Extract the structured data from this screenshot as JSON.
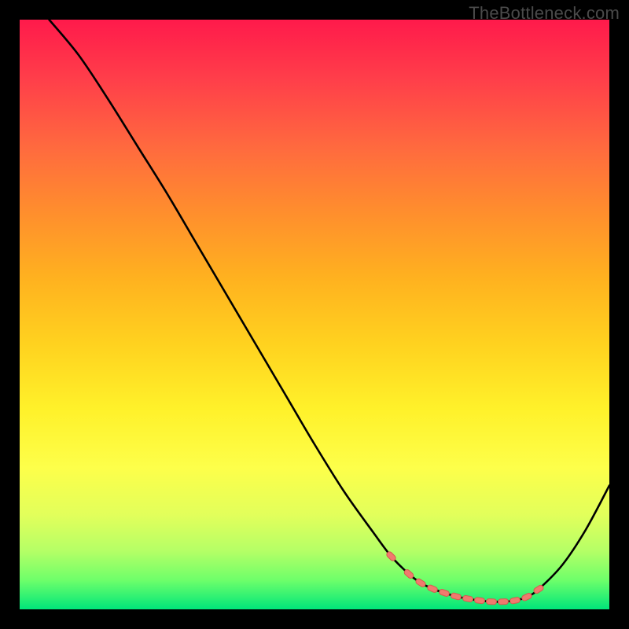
{
  "watermark": "TheBottleneck.com",
  "colors": {
    "frame": "#000000",
    "curve_stroke": "#000000",
    "dot_fill": "#f07a6e",
    "dot_stroke": "#d85a4e"
  },
  "chart_data": {
    "type": "line",
    "title": "",
    "xlabel": "",
    "ylabel": "",
    "xlim": [
      0,
      100
    ],
    "ylim": [
      0,
      100
    ],
    "grid": false,
    "legend": false,
    "series": [
      {
        "name": "bottleneck-curve",
        "x": [
          5,
          10,
          15,
          20,
          25,
          30,
          35,
          40,
          45,
          50,
          55,
          60,
          63,
          66,
          68,
          70,
          72,
          74,
          76,
          78,
          80,
          82,
          84,
          86,
          88,
          92,
          96,
          100
        ],
        "y": [
          100,
          94,
          86.5,
          78.5,
          70.5,
          62,
          53.5,
          45,
          36.5,
          28,
          20,
          13,
          9,
          6,
          4.5,
          3.5,
          2.8,
          2.2,
          1.8,
          1.5,
          1.3,
          1.3,
          1.5,
          2.1,
          3.4,
          7.5,
          13.5,
          21
        ]
      }
    ],
    "dots": {
      "name": "highlight-dots",
      "x": [
        63,
        66,
        68,
        70,
        72,
        74,
        76,
        78,
        80,
        82,
        84,
        86,
        88
      ],
      "y": [
        9,
        6,
        4.5,
        3.5,
        2.8,
        2.2,
        1.8,
        1.5,
        1.3,
        1.3,
        1.5,
        2.1,
        3.4
      ]
    }
  }
}
